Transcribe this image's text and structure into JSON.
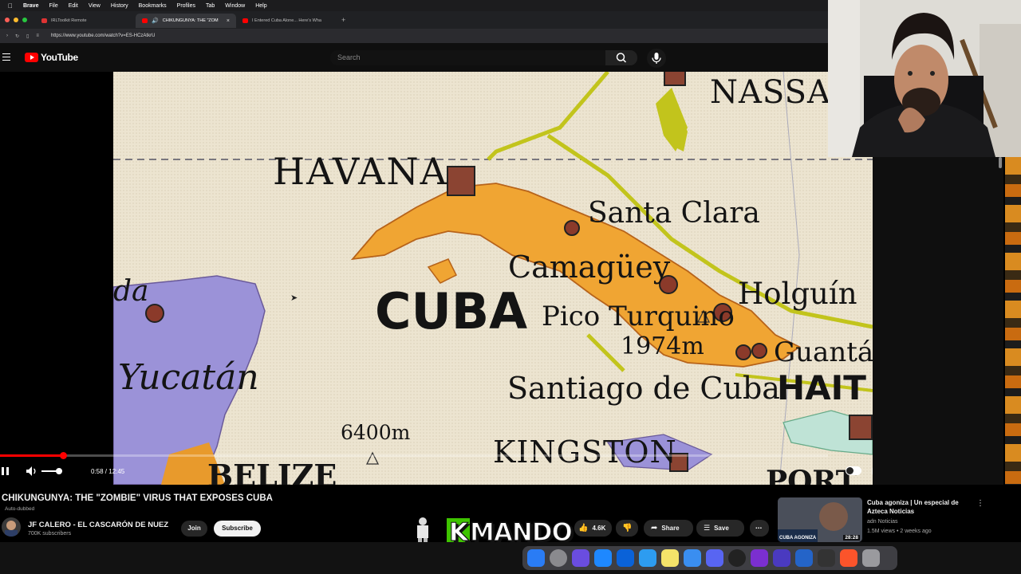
{
  "menubar": {
    "app": "Brave",
    "items": [
      "File",
      "Edit",
      "View",
      "History",
      "Bookmarks",
      "Profiles",
      "Tab",
      "Window",
      "Help"
    ]
  },
  "tabs": [
    {
      "title": "IRLToolkit Remote",
      "active": false
    },
    {
      "title": "CHIKUNGUNYA: THE \"ZOM",
      "active": true
    },
    {
      "title": "I Entered Cuba Alone... Here's Wha",
      "active": false
    }
  ],
  "address": {
    "url": "https://www.youtube.com/watch?v=ES-HCzAtkrU"
  },
  "youtube": {
    "logo": "YouTube",
    "search_placeholder": "Search"
  },
  "map_labels": {
    "nassau": "NASSAU",
    "havana": "HAVANA",
    "santa_clara": "Santa Clara",
    "camaguey": "Camagüey",
    "holguin": "Holguín",
    "cuba": "CUBA",
    "pico": "Pico Turquino",
    "pico_height": "1974m",
    "guantanamo": "Guantán",
    "haiti": "HAIT",
    "yucatan": "Yucatán",
    "da": "da",
    "santiago": "Santiago de Cuba",
    "depth": "6400m",
    "kingston": "KINGSTON",
    "belize": "BELIZE",
    "port": "PORT"
  },
  "player": {
    "timecode": "0:58 / 12:45",
    "progress": 0.076
  },
  "video": {
    "title": "CHIKUNGUNYA: THE \"ZOMBIE\" VIRUS THAT EXPOSES CUBA",
    "dubbed": "Auto-dubbed",
    "channel": "JF CALERO - EL CASCARÓN DE NUEZ",
    "subscribers": "700K subscribers",
    "join": "Join",
    "subscribe": "Subscribe",
    "likes": "4.6K",
    "share": "Share",
    "save": "Save"
  },
  "overlay": {
    "k": "K",
    "mando": "MANDO"
  },
  "recommendation": {
    "title": "Cuba agoniza | Un especial de Azteca Noticias",
    "channel": "adn Noticias",
    "meta": "1.5M views • 2 weeks ago",
    "duration": "28:28",
    "thumb_text": "CUBA AGONIZA"
  },
  "colors": {
    "accent": "#ff0000",
    "map_bg": "#ece4d0",
    "cuba": "#f0a533",
    "yucatan": "#9b92d8",
    "route": "#c2c41c"
  }
}
